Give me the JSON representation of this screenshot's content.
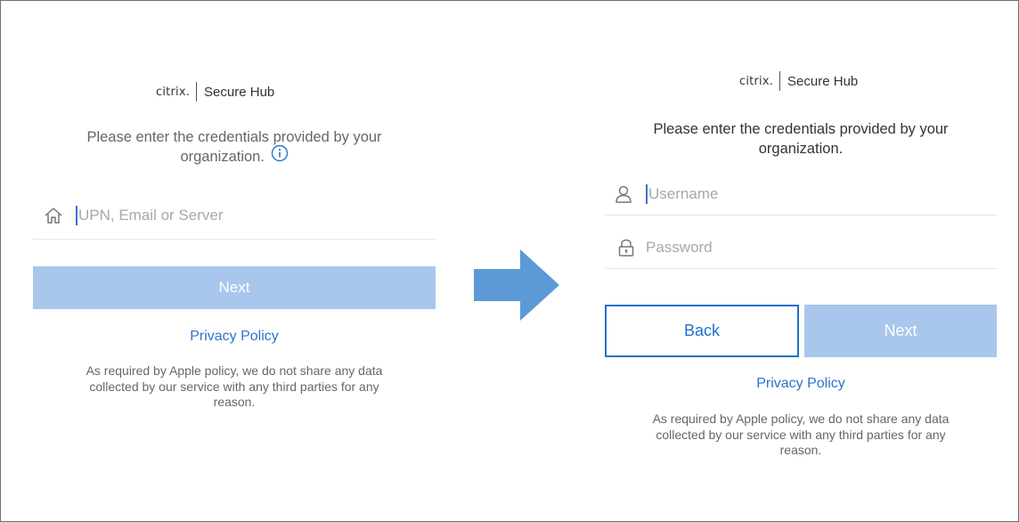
{
  "colors": {
    "accent": "#1f73c8",
    "next_disabled_bg": "#a9c6ec",
    "arrow": "#5b9ad6",
    "caret": "#3b6fd4"
  },
  "left_screen": {
    "logo": {
      "brand": "citrix.",
      "product": "Secure Hub"
    },
    "prompt_line1": "Please enter the credentials provided by your",
    "prompt_line2": "organization.",
    "info_icon": "info-circle-icon",
    "server_field": {
      "icon": "home-icon",
      "placeholder": "UPN, Email or Server"
    },
    "next_label": "Next",
    "privacy_label": "Privacy Policy",
    "policy_text_lines": [
      "As required by Apple policy, we do not share any data",
      "collected by our service with any third parties for any",
      "reason."
    ]
  },
  "transition_arrow": {
    "icon": "right-arrow-icon"
  },
  "right_screen": {
    "logo": {
      "brand": "citrix.",
      "product": "Secure Hub"
    },
    "prompt_line1": "Please enter the credentials provided by your",
    "prompt_line2": "organization.",
    "username_field": {
      "icon": "user-icon",
      "placeholder": "Username"
    },
    "password_field": {
      "icon": "lock-icon",
      "placeholder": "Password"
    },
    "back_label": "Back",
    "next_label": "Next",
    "privacy_label": "Privacy Policy",
    "policy_text_lines": [
      "As required by Apple policy, we do not share any data",
      "collected by our service with any third parties for any",
      "reason."
    ]
  }
}
